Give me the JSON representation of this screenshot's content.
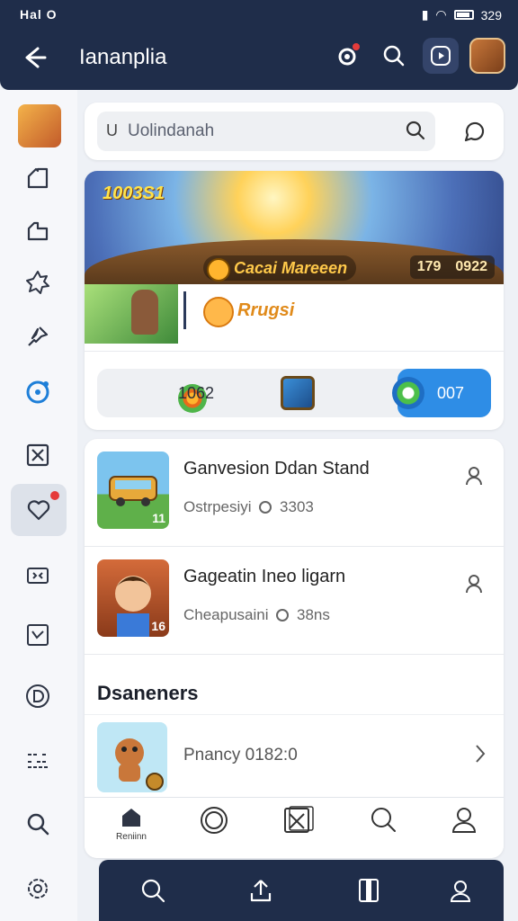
{
  "status_bar": {
    "left": "Hal O",
    "time": "329"
  },
  "header": {
    "title": "Iananplia"
  },
  "search": {
    "value": "Uolindanah"
  },
  "hero": {
    "score": "1003S1",
    "game_name": "Cacai Mareeen",
    "stats": [
      "179",
      "0922"
    ],
    "featured_label": "Rrugsi",
    "actions": {
      "count": "1062",
      "button_label": "007"
    }
  },
  "list": {
    "items": [
      {
        "title": "Ganvesion Ddan Stand",
        "meta_prefix": "Ostrpesiyi",
        "meta_value": "3303",
        "badge": "11"
      },
      {
        "title": "Gageatin Ineo ligarn",
        "meta_prefix": "Cheapusaini",
        "meta_value": "38ns",
        "badge": "16"
      }
    ],
    "section_title": "Dsaneners",
    "section_item": {
      "title": "Pnancy 0182:0"
    }
  },
  "tabbar": {
    "home_label": "Reniinn"
  },
  "colors": {
    "navy": "#1f2d4a",
    "accent": "#2e8de6",
    "badge_red": "#e53b3b"
  }
}
